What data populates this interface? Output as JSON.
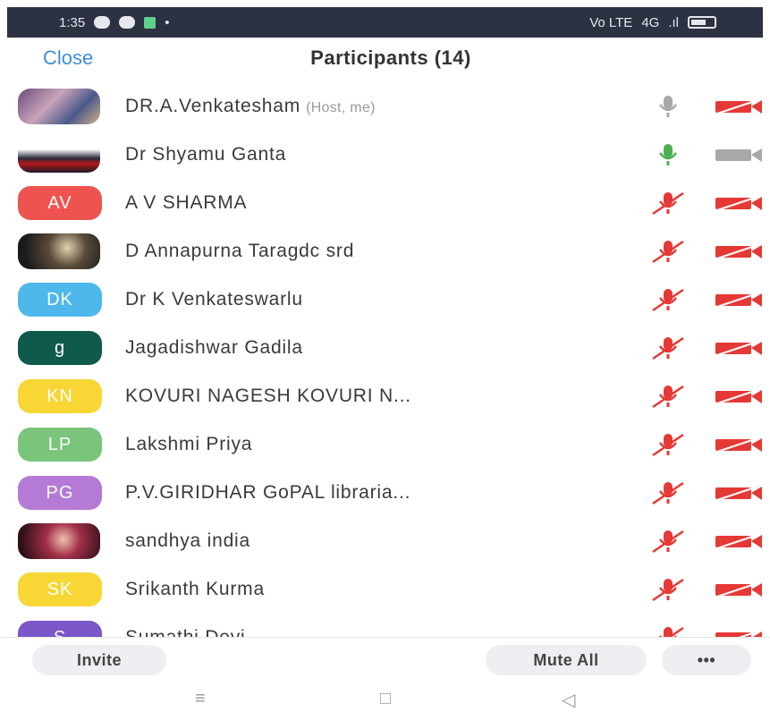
{
  "status_bar": {
    "time": "1:35",
    "right_text": "Vo LTE",
    "network": "4G"
  },
  "header": {
    "close_label": "Close",
    "title": "Participants (14)"
  },
  "participants": [
    {
      "name": "DR.A.Venkatesham",
      "tag": "(Host, me)",
      "avatar_type": "photo",
      "mic": "muted-gray",
      "video": "off"
    },
    {
      "name": "Dr Shyamu Ganta",
      "tag": "",
      "avatar_type": "photo",
      "mic": "active",
      "video": "on"
    },
    {
      "name": "A V SHARMA",
      "tag": "",
      "initials": "AV",
      "color": "#ef5350",
      "mic": "muted",
      "video": "off"
    },
    {
      "name": "D Annapurna Taragdc srd",
      "tag": "",
      "avatar_type": "photo",
      "mic": "muted",
      "video": "off"
    },
    {
      "name": "Dr K Venkateswarlu",
      "tag": "",
      "initials": "DK",
      "color": "#4fb8ea",
      "mic": "muted",
      "video": "off"
    },
    {
      "name": "Jagadishwar Gadila",
      "tag": "",
      "initials": "g",
      "color": "#0f5a4a",
      "mic": "muted",
      "video": "off"
    },
    {
      "name": "KOVURI NAGESH KOVURI N...",
      "tag": "",
      "initials": "KN",
      "color": "#f7d635",
      "mic": "muted",
      "video": "off"
    },
    {
      "name": "Lakshmi Priya",
      "tag": "",
      "initials": "LP",
      "color": "#7ac47c",
      "mic": "muted",
      "video": "off"
    },
    {
      "name": "P.V.GIRIDHAR GoPAL libraria...",
      "tag": "",
      "initials": "PG",
      "color": "#b57ad6",
      "mic": "muted",
      "video": "off"
    },
    {
      "name": "sandhya india",
      "tag": "",
      "avatar_type": "photo",
      "mic": "muted",
      "video": "off"
    },
    {
      "name": "Srikanth Kurma",
      "tag": "",
      "initials": "SK",
      "color": "#f7d635",
      "mic": "muted",
      "video": "off"
    },
    {
      "name": "Sumathi Devi",
      "tag": "",
      "initials": "S",
      "color": "#7b57c7",
      "mic": "muted",
      "video": "off"
    }
  ],
  "footer": {
    "invite_label": "Invite",
    "mute_all_label": "Mute All",
    "more_label": "•••"
  },
  "nav": {
    "menu_icon": "≡",
    "home_icon": "□",
    "back_icon": "◁"
  },
  "colors": {
    "accent": "#3d8ed8",
    "muted_red": "#e53935",
    "active_green": "#4caf50"
  }
}
